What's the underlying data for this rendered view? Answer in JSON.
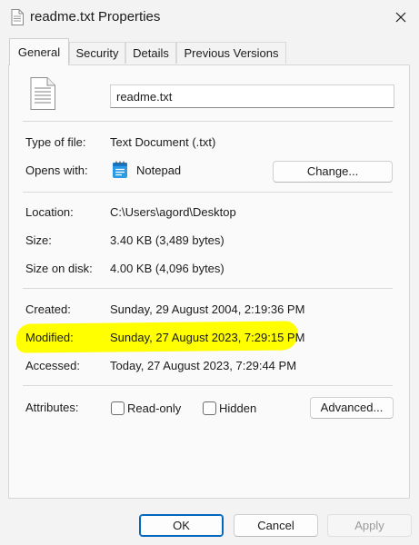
{
  "window": {
    "title": "readme.txt Properties",
    "close_icon": "close-icon"
  },
  "tabs": [
    {
      "label": "General",
      "active": true
    },
    {
      "label": "Security",
      "active": false
    },
    {
      "label": "Details",
      "active": false
    },
    {
      "label": "Previous Versions",
      "active": false
    }
  ],
  "general": {
    "file_name": "readme.txt",
    "type_label": "Type of file:",
    "type_value": "Text Document (.txt)",
    "opens_label": "Opens with:",
    "opens_value": "Notepad",
    "change_button": "Change...",
    "location_label": "Location:",
    "location_value": "C:\\Users\\agord\\Desktop",
    "size_label": "Size:",
    "size_value": "3.40 KB (3,489 bytes)",
    "size_on_disk_label": "Size on disk:",
    "size_on_disk_value": "4.00 KB (4,096 bytes)",
    "created_label": "Created:",
    "created_value": "Sunday, 29 August 2004, 2:19:36 PM",
    "modified_label": "Modified:",
    "modified_value": "Sunday, 27 August 2023, 7:29:15 PM",
    "accessed_label": "Accessed:",
    "accessed_value": "Today, 27 August 2023, 7:29:44 PM",
    "attributes_label": "Attributes:",
    "readonly_label": "Read-only",
    "readonly_checked": false,
    "hidden_label": "Hidden",
    "hidden_checked": false,
    "advanced_button": "Advanced..."
  },
  "footer": {
    "ok": "OK",
    "cancel": "Cancel",
    "apply": "Apply"
  },
  "colors": {
    "highlight": "#ffff00",
    "accent": "#0067c0",
    "disabled_text": "#9a9a9a"
  }
}
